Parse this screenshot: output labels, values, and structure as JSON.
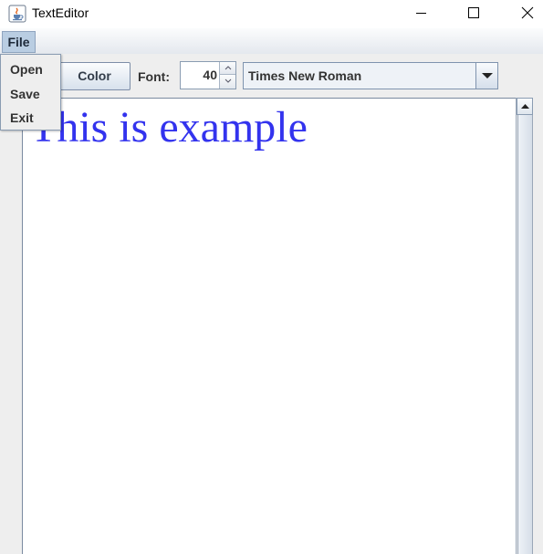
{
  "window": {
    "title": "TextEditor",
    "icon": "java-cup-icon"
  },
  "menubar": {
    "file_label": "File"
  },
  "file_menu": {
    "items": [
      {
        "label": "Open"
      },
      {
        "label": "Save"
      },
      {
        "label": "Exit"
      }
    ]
  },
  "toolbar": {
    "color_button_label": "Color",
    "font_label": "Font:",
    "font_size": "40",
    "font_family": "Times New Roman"
  },
  "editor": {
    "text": "This is example",
    "text_color": "#3333ee"
  },
  "colors": {
    "menu_highlight": "#b9cde2",
    "button_gradient_bottom": "#d7e1ec"
  }
}
